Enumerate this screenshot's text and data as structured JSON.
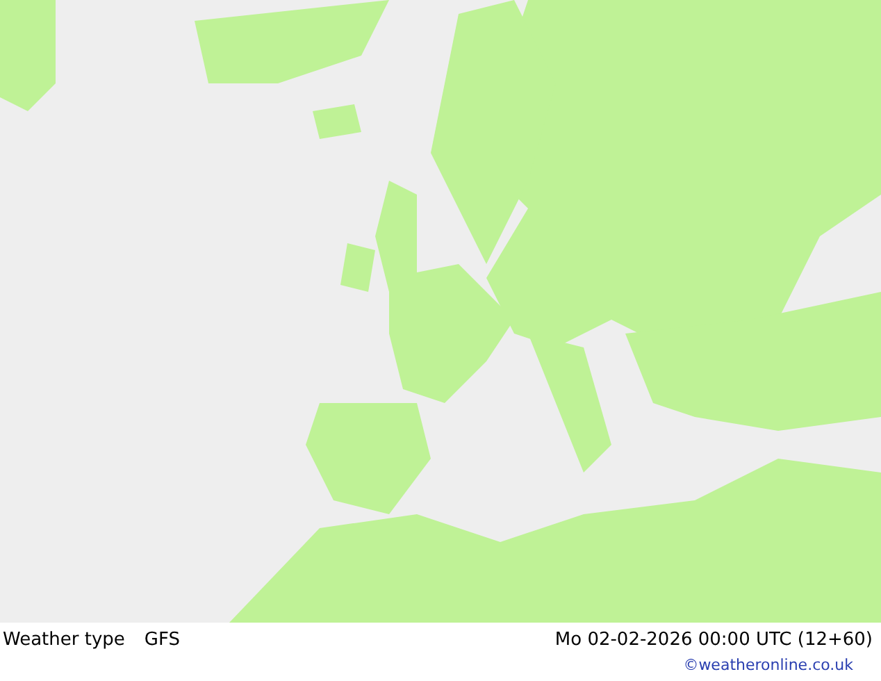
{
  "footer": {
    "title": "Weather type",
    "model": "GFS",
    "datetime": "Mo 02-02-2026 00:00 UTC (12+60)",
    "credit": "©weatheronline.co.uk"
  }
}
